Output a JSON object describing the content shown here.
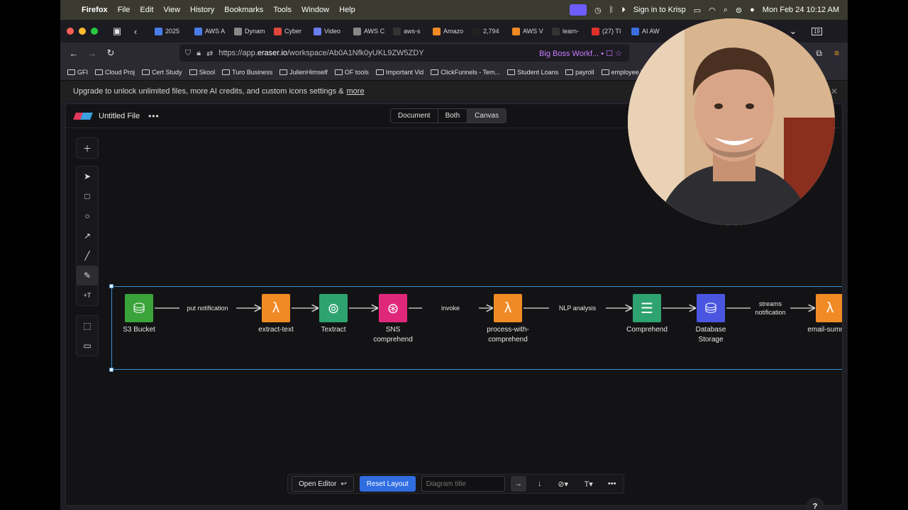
{
  "menubar": {
    "app": "Firefox",
    "items": [
      "File",
      "Edit",
      "View",
      "History",
      "Bookmarks",
      "Tools",
      "Window",
      "Help"
    ],
    "krisp": "Sign in to Krisp",
    "clock": "Mon Feb 24  10:12 AM"
  },
  "tabs": [
    {
      "label": "2025",
      "color": "#4a7ce8"
    },
    {
      "label": "AWS A",
      "color": "#4a7ce8"
    },
    {
      "label": "Dynam",
      "color": "#888888"
    },
    {
      "label": "Cyber",
      "color": "#e0463b"
    },
    {
      "label": "Video",
      "color": "#6b7cf0"
    },
    {
      "label": "AWS C",
      "color": "#888888"
    },
    {
      "label": "aws-s",
      "color": "#333333"
    },
    {
      "label": "Amazo",
      "color": "#f08a24"
    },
    {
      "label": "2,794",
      "color": "#222222"
    },
    {
      "label": "AWS V",
      "color": "#f08a24"
    },
    {
      "label": "learn-",
      "color": "#333333"
    },
    {
      "label": "(27) TI",
      "color": "#e0302a"
    },
    {
      "label": "AI AW",
      "color": "#3b6ee0"
    }
  ],
  "tab_count": "19",
  "url": {
    "prefix": "https://app.",
    "host": "eraser.io",
    "path": "/workspace/Ab0A1Nfk0yUKL9ZW5ZDY",
    "bookmark_label": "Big Boss Workf..."
  },
  "bookmarks": [
    "GFI",
    "Cloud Proj",
    "Cert Study",
    "Skool",
    "Turo Business",
    "JulienHimself",
    "OF tools",
    "Important Vid",
    "ClickFunnels - Tem...",
    "Student Loans",
    "payroll",
    "employee login"
  ],
  "banner": {
    "text": "Upgrade to unlock unlimited files, more AI credits, and custom icons settings &",
    "link": "more"
  },
  "app": {
    "file_name": "Untitled File",
    "views": [
      "Document",
      "Both",
      "Canvas"
    ],
    "active_view": "Canvas"
  },
  "diagram": {
    "nodes": [
      {
        "id": "s3",
        "label": "S3 Bucket",
        "color": "#3aa33a"
      },
      {
        "id": "extract",
        "label": "extract-text",
        "color": "#f08a24"
      },
      {
        "id": "textract",
        "label": "Textract",
        "color": "#2ea36f"
      },
      {
        "id": "sns",
        "label": "SNS comprehend",
        "color": "#e0287a"
      },
      {
        "id": "process",
        "label": "process-with-comprehend",
        "color": "#f08a24"
      },
      {
        "id": "comprehend",
        "label": "Comprehend",
        "color": "#2ea36f"
      },
      {
        "id": "db",
        "label": "Database Storage",
        "color": "#4a56e0"
      },
      {
        "id": "email",
        "label": "email-summar",
        "color": "#f08a24"
      }
    ],
    "edges": [
      {
        "from": "s3",
        "to": "extract",
        "label": "put notification"
      },
      {
        "from": "extract",
        "to": "textract",
        "label": ""
      },
      {
        "from": "textract",
        "to": "sns",
        "label": ""
      },
      {
        "from": "sns",
        "to": "process",
        "label": "invoke"
      },
      {
        "from": "process",
        "to": "comprehend",
        "label": "NLP analysis"
      },
      {
        "from": "comprehend",
        "to": "db",
        "label": ""
      },
      {
        "from": "db",
        "to": "email",
        "label": "streams notification"
      }
    ]
  },
  "bottom": {
    "open_editor": "Open Editor",
    "reset_layout": "Reset Layout",
    "title_placeholder": "Diagram title"
  },
  "help": "?"
}
